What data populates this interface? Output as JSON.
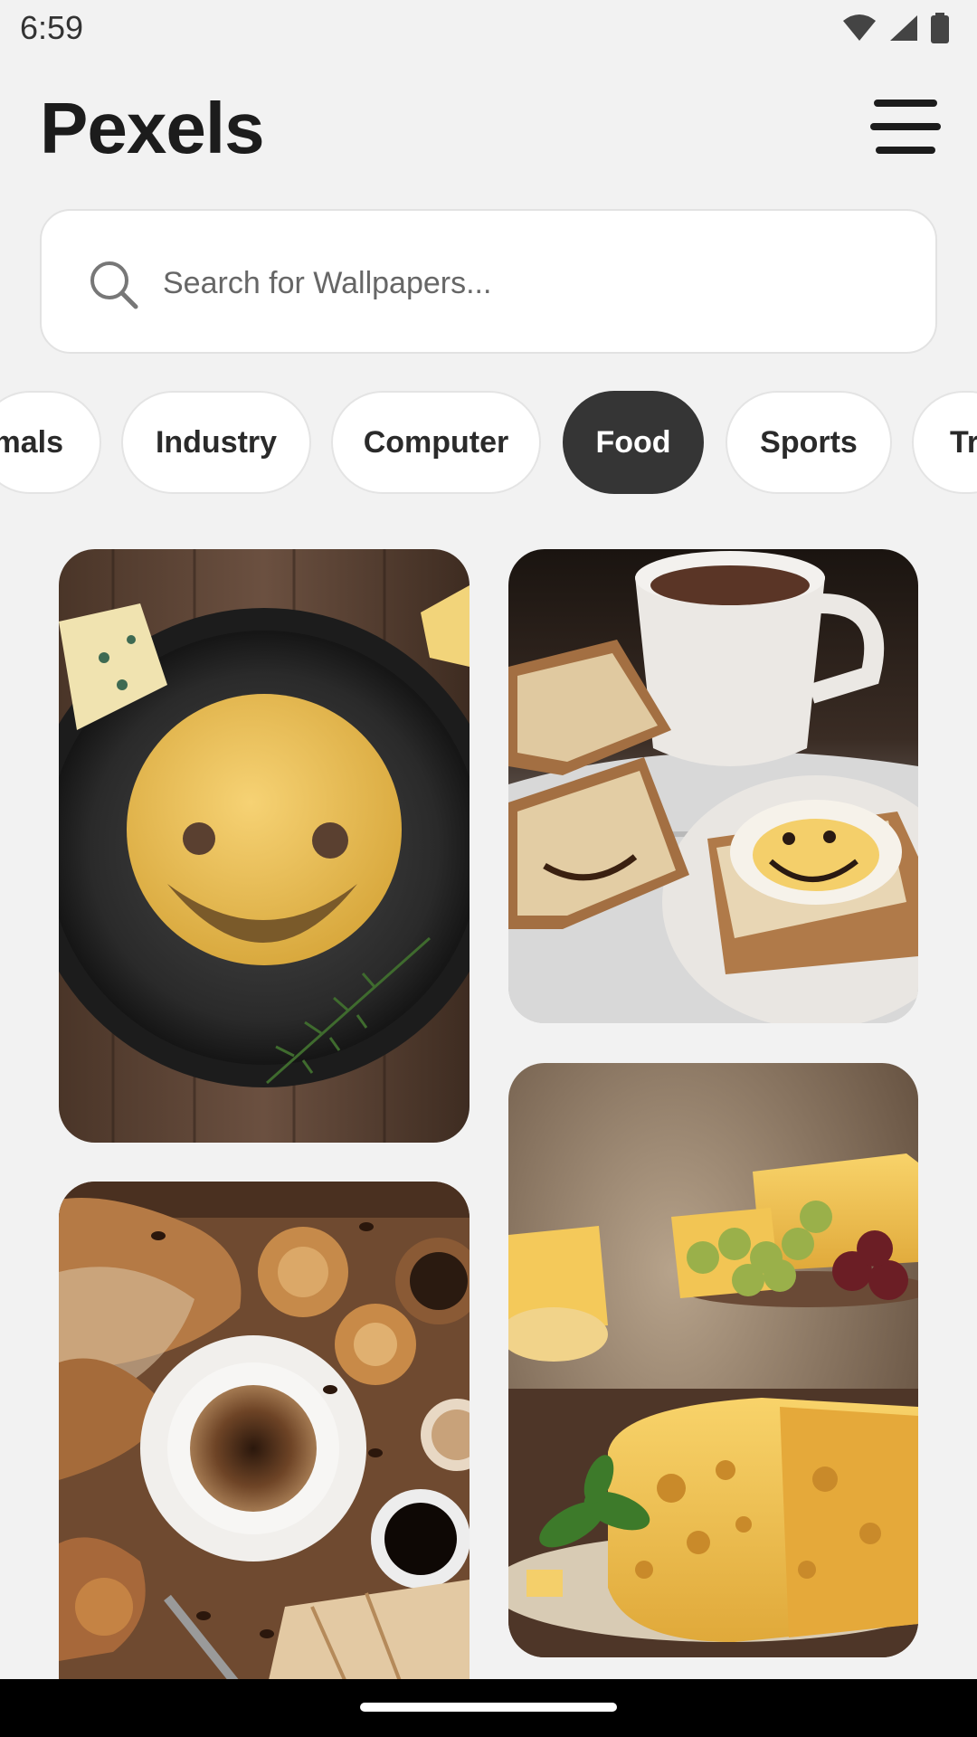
{
  "status_bar": {
    "time": "6:59",
    "icons": [
      "wifi-icon",
      "signal-icon",
      "battery-icon"
    ]
  },
  "header": {
    "title": "Pexels",
    "menu_icon": "hamburger-menu-icon"
  },
  "search": {
    "placeholder": "Search for Wallpapers...",
    "value": "",
    "icon": "search-icon"
  },
  "categories": {
    "selected": "Food",
    "items": [
      {
        "label": "Animals",
        "visible_text": "mals"
      },
      {
        "label": "Industry"
      },
      {
        "label": "Computer"
      },
      {
        "label": "Food"
      },
      {
        "label": "Sports"
      },
      {
        "label": "Travel",
        "visible_text": "Tr"
      }
    ]
  },
  "photos": [
    {
      "subject": "smiley-face-cheese-on-plate"
    },
    {
      "subject": "coffee-and-bread-with-smiley-toast"
    },
    {
      "subject": "bread-pastries-and-coffee"
    },
    {
      "subject": "cheese-board-with-grapes"
    }
  ],
  "colors": {
    "background": "#f2f2f2",
    "chip_active": "#353535",
    "chip_inactive": "#ffffff",
    "text_primary": "#1c1c1c"
  }
}
